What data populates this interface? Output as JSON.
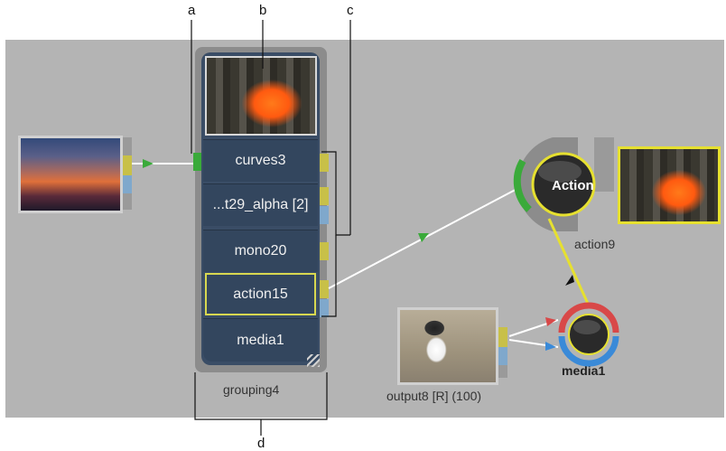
{
  "callouts": {
    "a": "a",
    "b": "b",
    "c": "c",
    "d": "d"
  },
  "group": {
    "name": "grouping4",
    "rows": [
      "curves3",
      "...t29_alpha [2]",
      "mono20",
      "action15",
      "media1"
    ]
  },
  "action_node": {
    "text": "Action",
    "label": "action9"
  },
  "media_node": {
    "label": "media1"
  },
  "output_node": {
    "label": "output8 [R] (100)"
  },
  "colors": {
    "link": "#ffffff",
    "arrow_green": "#3aaa3a",
    "selected_yellow": "#e6e030",
    "media_red": "#d84848",
    "media_blue": "#3a8ad8"
  }
}
